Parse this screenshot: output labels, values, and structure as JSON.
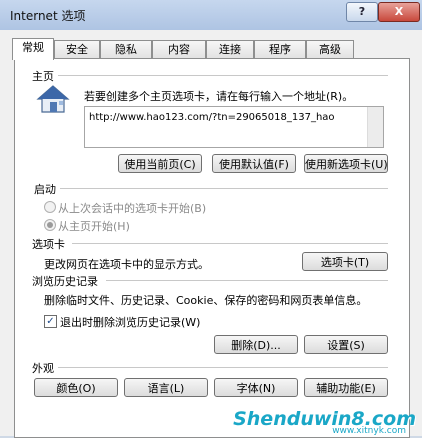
{
  "window": {
    "title": "Internet 选项",
    "help_glyph": "?",
    "close_glyph": "X"
  },
  "tabs": [
    {
      "label": "常规",
      "active": true
    },
    {
      "label": "安全"
    },
    {
      "label": "隐私"
    },
    {
      "label": "内容"
    },
    {
      "label": "连接"
    },
    {
      "label": "程序"
    },
    {
      "label": "高级"
    }
  ],
  "homepage": {
    "group_title": "主页",
    "instruction": "若要创建多个主页选项卡，请在每行输入一个地址(R)。",
    "url": "http://www.hao123.com/?tn=29065018_137_hao",
    "buttons": {
      "use_current": "使用当前页(C)",
      "use_default": "使用默认值(F)",
      "use_new_tab": "使用新选项卡(U)"
    }
  },
  "startup": {
    "group_title": "启动",
    "option_last_session": "从上次会话中的选项卡开始(B)",
    "option_home": "从主页开始(H)"
  },
  "tabs_section": {
    "group_title": "选项卡",
    "description": "更改网页在选项卡中的显示方式。",
    "button": "选项卡(T)"
  },
  "history": {
    "group_title": "浏览历史记录",
    "description": "删除临时文件、历史记录、Cookie、保存的密码和网页表单信息。",
    "checkbox_label": "退出时删除浏览历史记录(W)",
    "checkbox_checked": true,
    "delete_button": "删除(D)...",
    "settings_button": "设置(S)"
  },
  "appearance": {
    "group_title": "外观",
    "colors_button": "颜色(O)",
    "languages_button": "语言(L)",
    "fonts_button": "字体(N)",
    "accessibility_button": "辅助功能(E)"
  },
  "watermark": {
    "brand": "Shenduwin8.com",
    "sub": "www.xitnyk.com"
  },
  "colors": {
    "title_bar": "#aec4e3",
    "watermark": "#1aa7c7"
  }
}
